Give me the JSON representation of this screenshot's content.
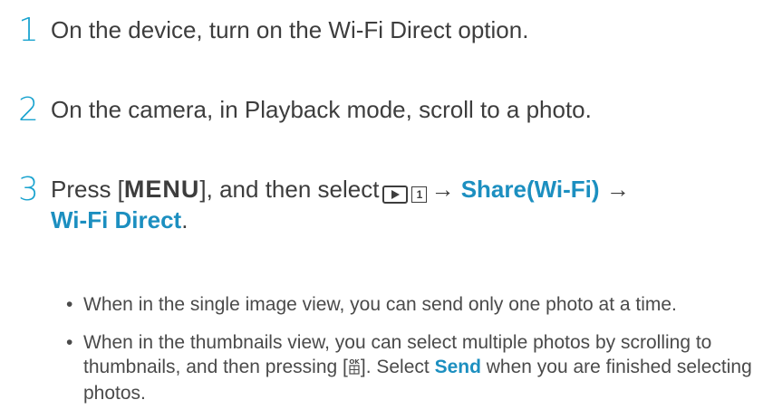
{
  "steps": [
    {
      "number": "1",
      "text": "On the device, turn on the Wi-Fi Direct option."
    },
    {
      "number": "2",
      "text": "On the camera, in Playback mode, scroll to a photo."
    },
    {
      "number": "3",
      "text_press": "Press [",
      "menu_key": "MENU",
      "text_then": "], and then select",
      "playback_page": "1",
      "arrow1": "→",
      "share_label": "Share(Wi-Fi)",
      "arrow2": "→",
      "wifi_direct_label": "Wi-Fi Direct",
      "period": "."
    }
  ],
  "bullets": [
    {
      "dot": "•",
      "text": "When in the single image view, you can send only one photo at a time."
    },
    {
      "dot": "•",
      "text_before": "When in the thumbnails view, you can select multiple photos by scrolling to thumbnails, and then pressing [",
      "ok_icon": "ok-grid-icon",
      "text_mid": "]. Select ",
      "send_label": "Send",
      "text_after": " when you are finished selecting photos."
    }
  ],
  "colors": {
    "accent": "#19a3cf",
    "highlight": "#1c8fc0",
    "text": "#3d3d3d"
  }
}
